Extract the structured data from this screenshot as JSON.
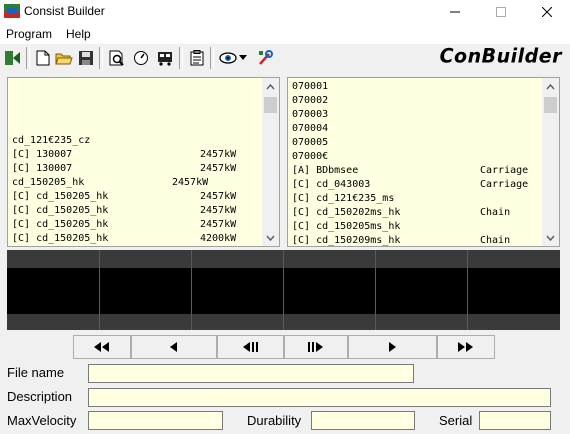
{
  "window": {
    "title": "Consist Builder",
    "minimize_icon": "minimize-icon",
    "maximize_icon": "maximize-icon",
    "close_icon": "close-icon"
  },
  "menu": [
    {
      "label": "Program"
    },
    {
      "label": "Help"
    }
  ],
  "toolbar": {
    "brand": "ConBuilder",
    "buttons": [
      "exit-icon",
      "new-file-icon",
      "open-folder-icon",
      "save-icon",
      "preview-icon",
      "compass-icon",
      "train-icon",
      "notes-icon",
      "eye-icon",
      "dropdown-arrow-icon",
      "tools-icon"
    ]
  },
  "left_list": {
    "items": [
      {
        "text": "cd_121€235_cz",
        "value": ""
      },
      {
        "text": "[C] 130007",
        "value": "2457kW"
      },
      {
        "text": "[C] 130007",
        "value": "2457kW"
      },
      {
        "text": "cd_150205_hk",
        "value": "2457kW"
      },
      {
        "text": "[C] cd_150205_hk",
        "value": "2457kW"
      },
      {
        "text": "[C] cd_150205_hk",
        "value": "2457kW"
      },
      {
        "text": "[C] cd_150205_hk",
        "value": "2457kW"
      },
      {
        "text": "[C] cd_150205_hk",
        "value": "4200kW"
      }
    ]
  },
  "right_list": {
    "items": [
      {
        "text": "070001",
        "type": ""
      },
      {
        "text": "070002",
        "type": ""
      },
      {
        "text": "070003",
        "type": ""
      },
      {
        "text": "070004",
        "type": ""
      },
      {
        "text": "070005",
        "type": ""
      },
      {
        "text": "07000€",
        "type": ""
      },
      {
        "text": "[A] BDbmsee",
        "type": "Carriage"
      },
      {
        "text": "[C] cd_043003",
        "type": "Carriage"
      },
      {
        "text": "[C] cd_121€235_ms",
        "type": ""
      },
      {
        "text": "[C] cd_150202ms_hk",
        "type": "Chain"
      },
      {
        "text": "[C] cd_150205ms_hk",
        "type": ""
      },
      {
        "text": "[C] cd_150209ms_hk",
        "type": "Chain"
      }
    ]
  },
  "nav": {
    "first": "◀◀",
    "prev": "◀",
    "prev_unit": "◀||",
    "next_unit": "||▶",
    "next": "▶",
    "last": "▶▶"
  },
  "form": {
    "file_name_label": "File name",
    "file_name_value": "",
    "description_label": "Description",
    "description_value": "",
    "max_velocity_label": "MaxVelocity",
    "max_velocity_value": "",
    "durability_label": "Durability",
    "durability_value": "",
    "serial_label": "Serial",
    "serial_value": ""
  }
}
